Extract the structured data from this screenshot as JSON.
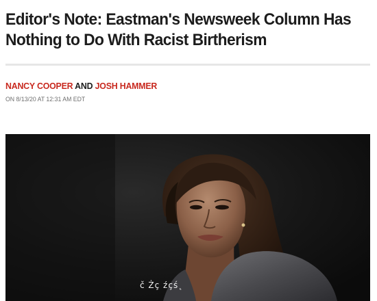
{
  "article": {
    "headline_line1": "Editor's Note: Eastman's Newsweek Column Has",
    "headline_line2": "Nothing to Do With Racist Birtherism",
    "byline": {
      "author1": "NANCY COOPER",
      "conjunction": "AND",
      "author2": "JOSH HAMMER"
    },
    "dateline": "ON 8/13/20 AT 12:31 AM EDT",
    "photo": {
      "overlay_text": "č Żç źçś˛"
    }
  },
  "colors": {
    "author_link": "#c8281e",
    "headline": "#1c1c1c",
    "dateline": "#6f6f6f"
  }
}
